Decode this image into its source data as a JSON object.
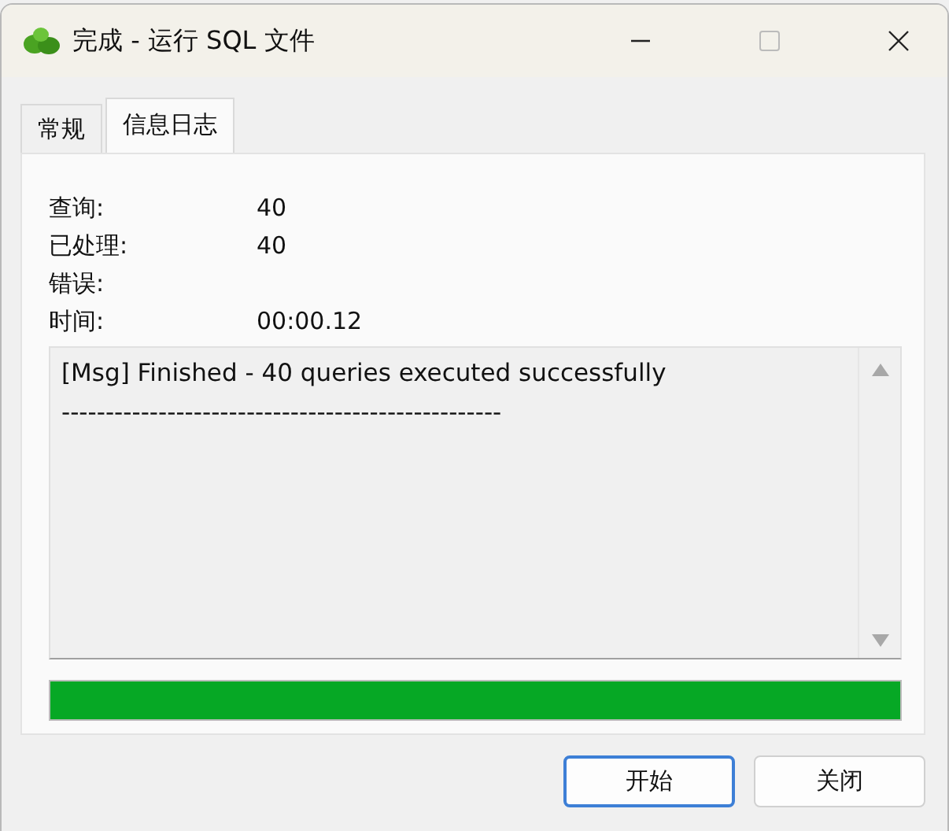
{
  "window": {
    "title": "完成 - 运行 SQL 文件"
  },
  "tabs": [
    {
      "label": "常规",
      "selected": false
    },
    {
      "label": "信息日志",
      "selected": true
    }
  ],
  "stats": [
    {
      "label": "查询:",
      "value": "40"
    },
    {
      "label": "已处理:",
      "value": "40"
    },
    {
      "label": "错误:"
    },
    {
      "label": "时间:",
      "value": "00:00.12"
    }
  ],
  "log": {
    "lines": [
      "[Msg] Finished - 40 queries executed successfully",
      "--------------------------------------------------"
    ]
  },
  "progress": {
    "level": 1
  },
  "buttons": [
    {
      "label": "开始",
      "default": true
    },
    {
      "label": "关闭",
      "default": false
    }
  ]
}
